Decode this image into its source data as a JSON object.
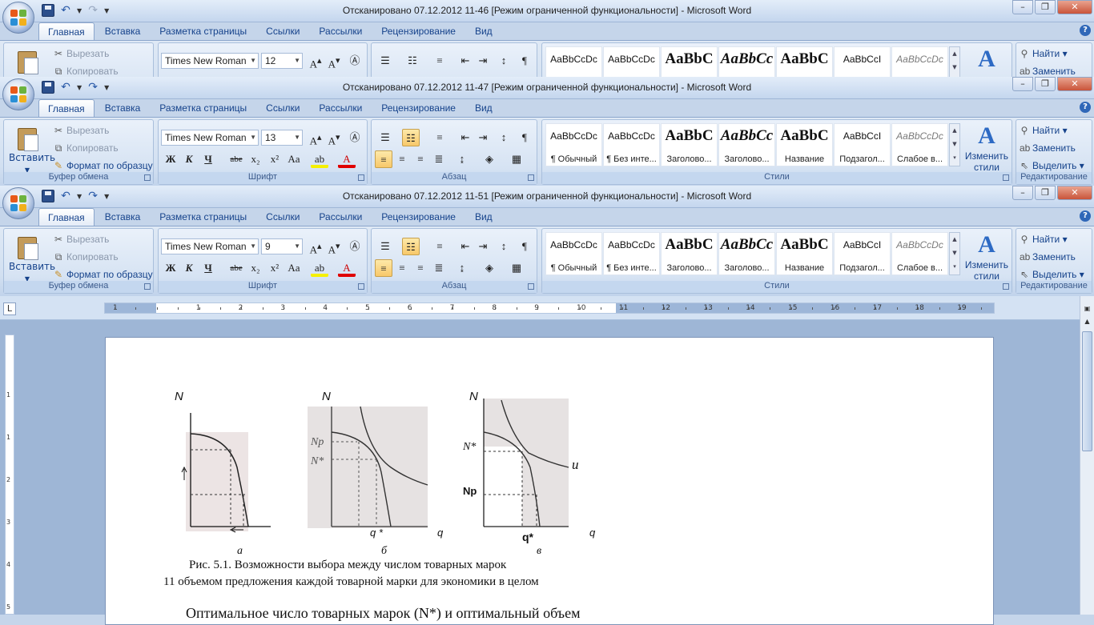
{
  "windows": [
    {
      "title": "Отсканировано 07.12.2012 11-46 [Режим ограниченной функциональности]  -  Microsoft Word",
      "font_name": "Times New Roman",
      "font_size": "12"
    },
    {
      "title": "Отсканировано 07.12.2012 11-47 [Режим ограниченной функциональности]  -  Microsoft Word",
      "font_name": "Times New Roman",
      "font_size": "13"
    },
    {
      "title": "Отсканировано 07.12.2012 11-51 [Режим ограниченной функциональности]  -  Microsoft Word",
      "font_name": "Times New Roman",
      "font_size": "9"
    }
  ],
  "tabs": [
    "Главная",
    "Вставка",
    "Разметка страницы",
    "Ссылки",
    "Рассылки",
    "Рецензирование",
    "Вид"
  ],
  "clipboard": {
    "paste": "Вставить",
    "cut": "Вырезать",
    "copy": "Копировать",
    "format_painter": "Формат по образцу",
    "group": "Буфер обмена"
  },
  "font_group": "Шрифт",
  "paragraph_group": "Абзац",
  "styles": {
    "items": [
      {
        "sample": "AaBbCcDc",
        "name": "¶ Обычный"
      },
      {
        "sample": "AaBbCcDc",
        "name": "¶ Без инте..."
      },
      {
        "sample": "AaBbC",
        "name": "Заголово..."
      },
      {
        "sample": "AaBbCc",
        "name": "Заголово..."
      },
      {
        "sample": "AaBbC",
        "name": "Название"
      },
      {
        "sample": "AaBbCcI",
        "name": "Подзагол..."
      },
      {
        "sample": "AaBbCcDc",
        "name": "Слабое в..."
      }
    ],
    "change": "Изменить стили",
    "group": "Стили"
  },
  "editing": {
    "find": "Найти",
    "replace": "Заменить",
    "select": "Выделить",
    "group": "Редактирование"
  },
  "ruler_numbers": [
    "1",
    "1",
    "2",
    "3",
    "4",
    "5",
    "6",
    "7",
    "8",
    "9",
    "10",
    "11",
    "12",
    "13",
    "14",
    "15",
    "16",
    "17",
    "18",
    "19"
  ],
  "vruler_numbers": [
    "1",
    "1",
    "2",
    "3",
    "4",
    "5"
  ],
  "document": {
    "figure": {
      "panel_a": {
        "ylabel": "N",
        "caption": "а"
      },
      "panel_b": {
        "ylabel": "N",
        "np_label": "Np",
        "nstar_label": "N*",
        "q_star": "q *",
        "q_label": "q",
        "caption": "б"
      },
      "panel_c": {
        "ylabel": "N",
        "nstar_label": "N*",
        "np_label": "Np",
        "u_label": "u",
        "q_star": "q*",
        "q_label": "q",
        "caption": "в"
      }
    },
    "caption_line1": "Рис. 5.1. Возможности выбора между числом товарных марок",
    "caption_line2": "11 объемом предложения каждой товарной марки для экономики в целом",
    "body_line": "Оптимальное число товарных марок (N*) и оптимальный объем"
  }
}
